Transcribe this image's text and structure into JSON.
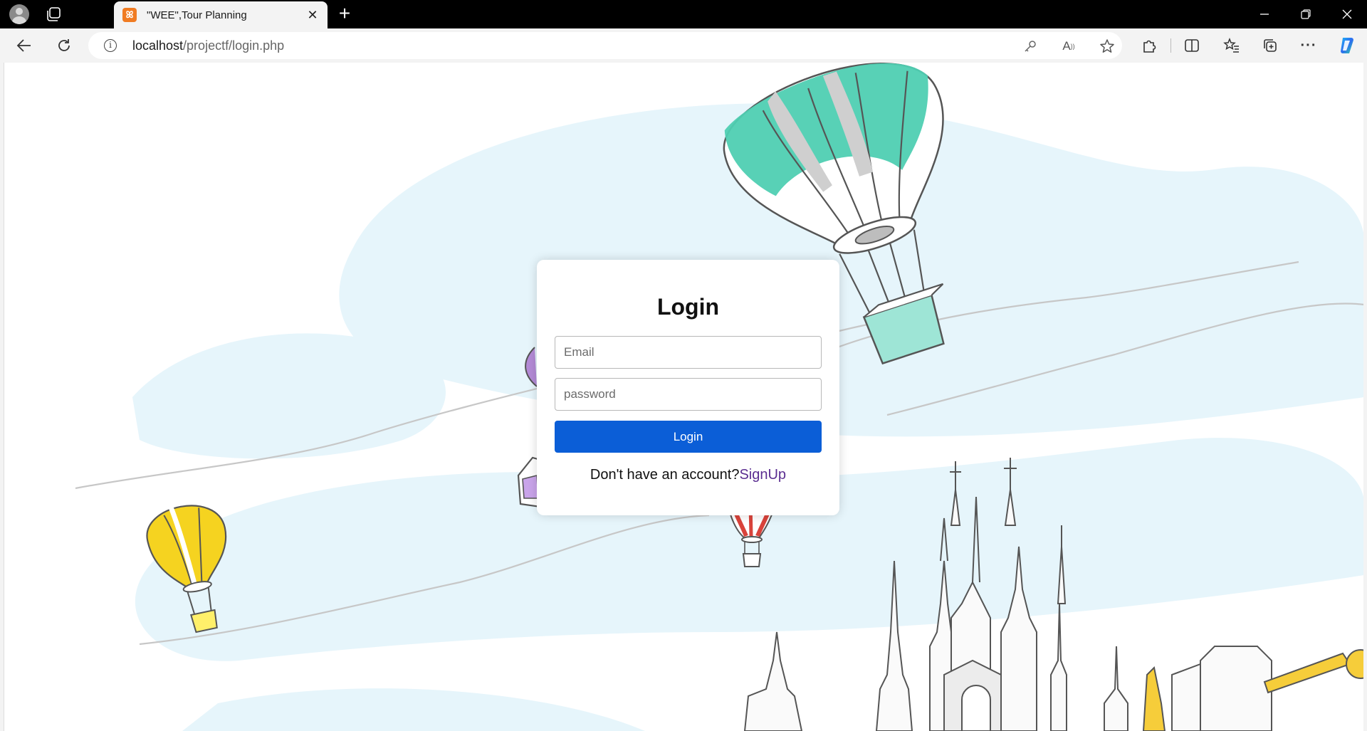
{
  "browser": {
    "tab_title": "\"WEE\",Tour Planning",
    "favicon_label": "ꕤ",
    "url_host": "localhost",
    "url_path": "/projectf/login.php"
  },
  "login": {
    "heading": "Login",
    "email_placeholder": "Email",
    "password_placeholder": "password",
    "submit_label": "Login",
    "signup_prompt": "Don't have an account?",
    "signup_link": "SignUp"
  },
  "colors": {
    "accent": "#0b5ed7",
    "link": "#5b2e91",
    "sky": "#e6f5fb",
    "balloon_teal": "#4fcfb2",
    "balloon_yellow": "#f5d320",
    "balloon_red": "#d9433b",
    "balloon_purple": "#b38ad6"
  }
}
